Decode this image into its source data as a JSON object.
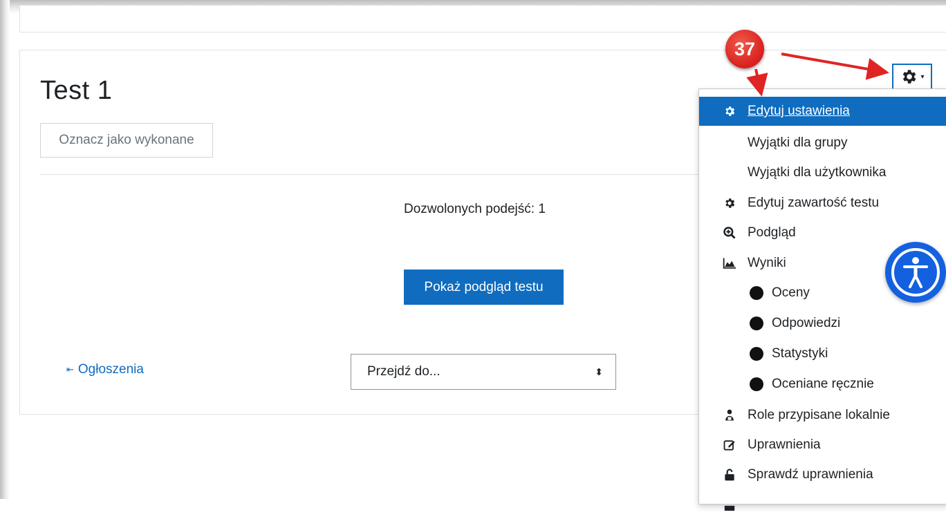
{
  "annotation": {
    "step_number": "37",
    "color": "#e02424"
  },
  "activity": {
    "title": "Test 1",
    "completion_button": "Oznacz jako wykonane",
    "attempts_text": "Dozwolonych podejść: 1",
    "preview_button": "Pokaż podgląd testu"
  },
  "navigation": {
    "previous_link": "Ogłoszenia",
    "previous_arrow_icon": "arrow-left-icon",
    "jump_to_placeholder": "Przejdź do..."
  },
  "actions_menu": {
    "toggle_icon": "gear-icon",
    "items": [
      {
        "label": "Edytuj ustawienia",
        "icon": "gear-icon",
        "active": true
      },
      {
        "label": "Wyjątki dla grupy",
        "icon": ""
      },
      {
        "label": "Wyjątki dla użytkownika",
        "icon": ""
      },
      {
        "label": "Edytuj zawartość testu",
        "icon": "gear-icon"
      },
      {
        "label": "Podgląd",
        "icon": "magnifier-plus-icon"
      },
      {
        "label": "Wyniki",
        "icon": "area-chart-icon"
      },
      {
        "label": "Oceny",
        "icon": "bullet-icon"
      },
      {
        "label": "Odpowiedzi",
        "icon": "bullet-icon"
      },
      {
        "label": "Statystyki",
        "icon": "bullet-icon"
      },
      {
        "label": "Oceniane ręcznie",
        "icon": "bullet-icon"
      },
      {
        "label": "Role przypisane lokalnie",
        "icon": "users-icon"
      },
      {
        "label": "Uprawnienia",
        "icon": "edit-icon"
      },
      {
        "label": "Sprawdź uprawnienia",
        "icon": "unlock-icon"
      }
    ]
  },
  "accessibility_button": {
    "icon": "accessibility-icon",
    "color": "#1461e0"
  },
  "colors": {
    "primary": "#0f6cbf",
    "text": "#1d2125",
    "border": "#dee2e6"
  }
}
